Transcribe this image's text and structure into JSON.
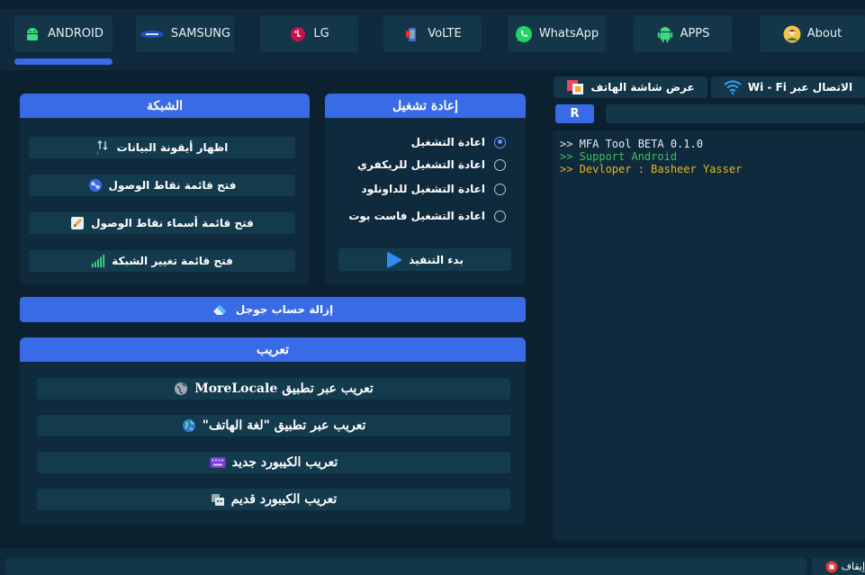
{
  "tabs": [
    {
      "label": "ANDROID",
      "icon": "android-icon"
    },
    {
      "label": "SAMSUNG",
      "icon": "samsung-logo"
    },
    {
      "label": "LG",
      "icon": "lg-logo"
    },
    {
      "label": "VoLTE",
      "icon": "volte-icon"
    },
    {
      "label": "WhatsApp",
      "icon": "whatsapp-icon"
    },
    {
      "label": "APPS",
      "icon": "android-apps-icon"
    },
    {
      "label": "About",
      "icon": "person-icon"
    }
  ],
  "active_tab": "ANDROID",
  "network_panel": {
    "title": "الشبكة",
    "buttons": [
      {
        "label": "اظهار أيقونة البيانات",
        "icon": "data-arrows-icon"
      },
      {
        "label": "فتح قائمة نقاط الوصول",
        "icon": "access-points-icon"
      },
      {
        "label": "فتح قائمة أسماء نقاط الوصول",
        "icon": "pencil-icon"
      },
      {
        "label": "فتح قائمة تغيير الشبكة",
        "icon": "signal-bars-icon"
      }
    ]
  },
  "reboot_panel": {
    "title": "إعادة تشغيل",
    "options": [
      {
        "label": "اعادة التشغيل",
        "selected": true
      },
      {
        "label": "اعادة التشغيل للريكفري",
        "selected": false
      },
      {
        "label": "اعادة التشغيل للداونلود",
        "selected": false
      },
      {
        "label": "اعادة التشغيل فاست بوت",
        "selected": false
      }
    ],
    "run_button": "بدء التنفيذ"
  },
  "remove_google": "إزالة حساب جوجل",
  "localize_panel": {
    "title": "تعريب",
    "buttons": [
      {
        "label": "تعريب عبر تطبيق MoreLocale",
        "icon": "globe-icon"
      },
      {
        "label": "تعريب عبر تطبيق \"لغة الهاتف\"",
        "icon": "earth-icon"
      },
      {
        "label": "تعريب الكيبورد جديد",
        "icon": "keyboard-icon"
      },
      {
        "label": "تعريب الكيبورد قديم",
        "icon": "keyboard-old-icon"
      }
    ]
  },
  "right": {
    "screen_tab": "عرض شاشة الهاتف",
    "wifi_tab": "الاتصال عبر Wi - Fi",
    "r_button": "R",
    "console_lines": [
      {
        "text": ">> MFA Tool BETA 0.1.0",
        "color": "#e8eef2"
      },
      {
        "text": ">> Support Android",
        "color": "#3fbf5a"
      },
      {
        "text": ">> Devloper : Basheer Yasser",
        "color": "#e6b422"
      }
    ]
  },
  "stop_button": "إيقاف",
  "colors": {
    "accent": "#3a6be6",
    "bg": "#0b2130",
    "panel": "#0f2a3c",
    "button": "#143a4e"
  }
}
